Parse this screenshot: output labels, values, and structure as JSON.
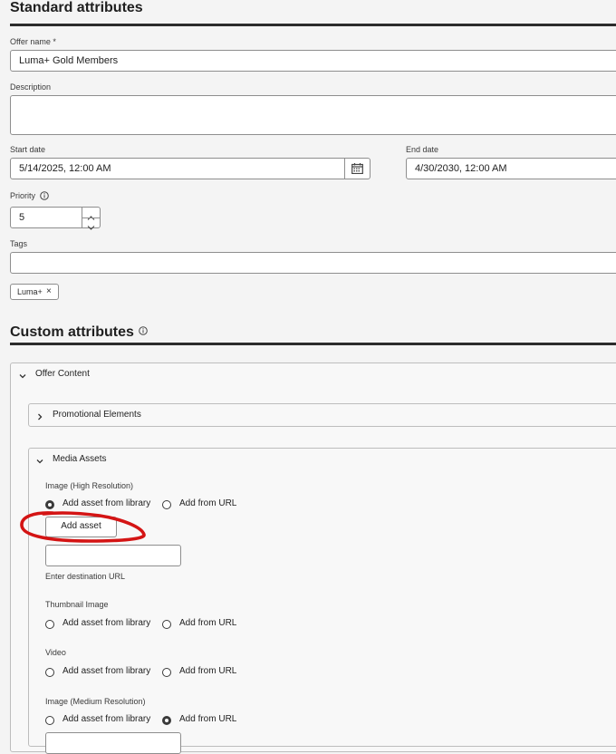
{
  "standard": {
    "title": "Standard attributes",
    "offer_name_label": "Offer name",
    "required_mark": "*",
    "offer_name_value": "Luma+ Gold Members",
    "description_label": "Description",
    "description_value": "",
    "start_date_label": "Start date",
    "start_date_value": "5/14/2025, 12:00  AM",
    "end_date_label": "End date",
    "end_date_value": "4/30/2030, 12:00  AM",
    "priority_label": "Priority",
    "priority_value": "5",
    "tags_label": "Tags",
    "tags_value": "",
    "tag_chip": "Luma+",
    "tag_remove": "×"
  },
  "custom": {
    "title": "Custom attributes",
    "offer_content_label": "Offer Content",
    "promotional_label": "Promotional Elements",
    "media_label": "Media Assets",
    "image_high": {
      "label": "Image (High Resolution)",
      "opt_library": "Add asset from library",
      "opt_url": "Add from URL",
      "selected": "library",
      "add_asset_button": "Add asset",
      "url_value": "",
      "url_caption": "Enter destination URL"
    },
    "thumbnail": {
      "label": "Thumbnail Image",
      "opt_library": "Add asset from library",
      "opt_url": "Add from URL"
    },
    "video": {
      "label": "Video",
      "opt_library": "Add asset from library",
      "opt_url": "Add from URL"
    },
    "image_medium": {
      "label": "Image (Medium Resolution)",
      "opt_library": "Add asset from library",
      "opt_url": "Add from URL",
      "selected": "url"
    }
  },
  "colors": {
    "annotation_circle": "#d41414",
    "text": "#2c2c2c",
    "background": "#f4f4f4"
  }
}
